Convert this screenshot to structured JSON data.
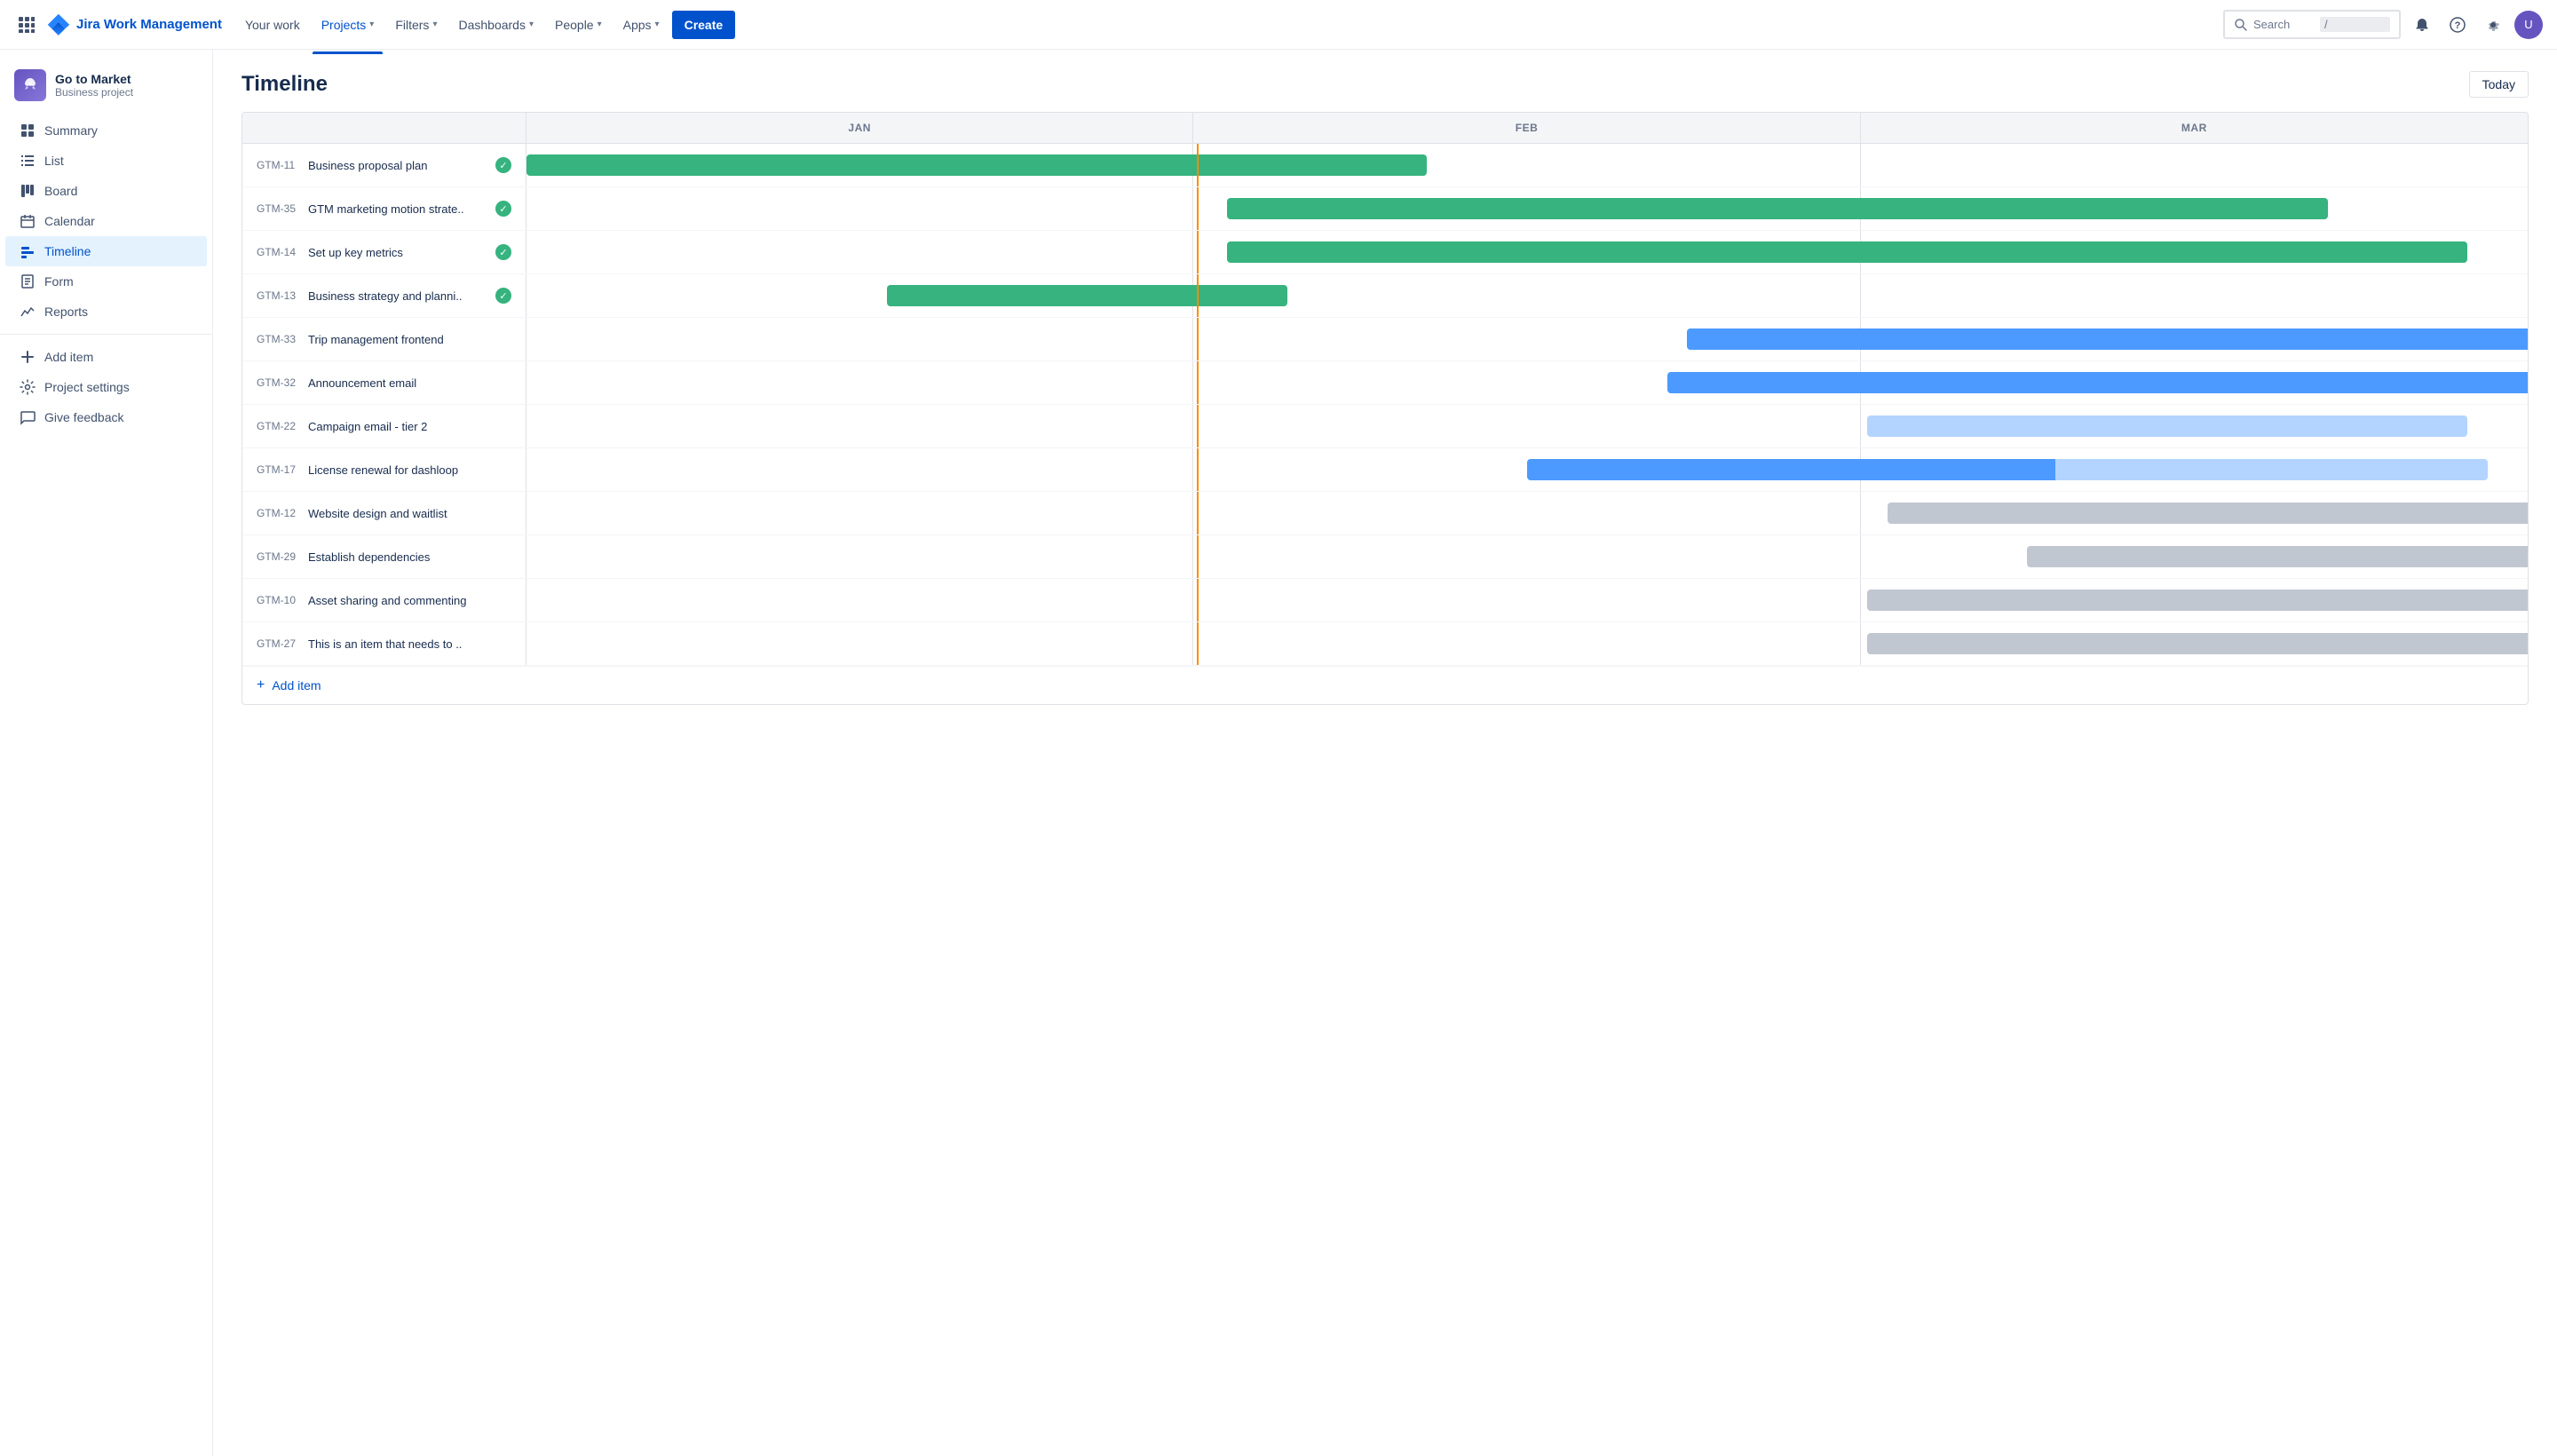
{
  "topnav": {
    "logo_text": "Jira Work Management",
    "nav_items": [
      {
        "label": "Your work",
        "active": false
      },
      {
        "label": "Projects",
        "active": true
      },
      {
        "label": "Filters",
        "active": false
      },
      {
        "label": "Dashboards",
        "active": false
      },
      {
        "label": "People",
        "active": false
      },
      {
        "label": "Apps",
        "active": false
      }
    ],
    "create_label": "Create",
    "search_placeholder": "Search",
    "search_shortcut": "/"
  },
  "project": {
    "name": "Go to Market",
    "type": "Business project"
  },
  "sidebar": {
    "items": [
      {
        "id": "summary",
        "label": "Summary",
        "icon": "summary"
      },
      {
        "id": "list",
        "label": "List",
        "icon": "list"
      },
      {
        "id": "board",
        "label": "Board",
        "icon": "board"
      },
      {
        "id": "calendar",
        "label": "Calendar",
        "icon": "calendar"
      },
      {
        "id": "timeline",
        "label": "Timeline",
        "icon": "timeline",
        "active": true
      },
      {
        "id": "form",
        "label": "Form",
        "icon": "form"
      },
      {
        "id": "reports",
        "label": "Reports",
        "icon": "reports"
      },
      {
        "id": "add-item",
        "label": "Add item",
        "icon": "add"
      },
      {
        "id": "project-settings",
        "label": "Project settings",
        "icon": "settings"
      },
      {
        "id": "give-feedback",
        "label": "Give feedback",
        "icon": "feedback"
      }
    ]
  },
  "page": {
    "title": "Timeline",
    "today_label": "Today"
  },
  "months": [
    "JAN",
    "FEB",
    "MAR"
  ],
  "timeline_rows": [
    {
      "id": "GTM-11",
      "name": "Business proposal plan",
      "done": true,
      "bar": {
        "color": "green",
        "col_start": "jan",
        "left_pct": 0,
        "width_pct": 45
      }
    },
    {
      "id": "GTM-35",
      "name": "GTM marketing motion strate..",
      "done": true,
      "bar": {
        "color": "green",
        "col_start": "jan",
        "left_pct": 35,
        "width_pct": 55
      }
    },
    {
      "id": "GTM-14",
      "name": "Set up key metrics",
      "done": true,
      "bar": {
        "color": "green",
        "col_start": "jan",
        "left_pct": 35,
        "width_pct": 62
      }
    },
    {
      "id": "GTM-13",
      "name": "Business strategy and planni..",
      "done": true,
      "bar": {
        "color": "green",
        "col_start": "jan",
        "left_pct": 18,
        "width_pct": 20
      }
    },
    {
      "id": "GTM-33",
      "name": "Trip management frontend",
      "done": false,
      "bar": {
        "color": "blue",
        "col_start": "jan",
        "left_pct": 58,
        "width_pct": 52
      }
    },
    {
      "id": "GTM-32",
      "name": "Announcement email",
      "done": false,
      "bar": {
        "color": "blue",
        "col_start": "jan",
        "left_pct": 57,
        "width_pct": 52
      }
    },
    {
      "id": "GTM-22",
      "name": "Campaign email - tier 2",
      "done": false,
      "bar": {
        "color": "lightblue",
        "col_start": "feb",
        "left_pct": 67,
        "width_pct": 30
      }
    },
    {
      "id": "GTM-17",
      "name": "License renewal for dashloop",
      "done": false,
      "bar": {
        "color": "mixed_blue",
        "col_start": "jan",
        "left_pct": 50,
        "width_pct": 48
      }
    },
    {
      "id": "GTM-12",
      "name": "Website design and waitlist",
      "done": false,
      "bar": {
        "color": "gray",
        "col_start": "feb",
        "left_pct": 68,
        "width_pct": 40
      }
    },
    {
      "id": "GTM-29",
      "name": "Establish dependencies",
      "done": false,
      "bar": {
        "color": "gray",
        "col_start": "mar",
        "left_pct": 75,
        "width_pct": 42
      }
    },
    {
      "id": "GTM-10",
      "name": "Asset sharing and commenting",
      "done": false,
      "bar": {
        "color": "gray",
        "col_start": "feb",
        "left_pct": 67,
        "width_pct": 35
      }
    },
    {
      "id": "GTM-27",
      "name": "This is an item that needs to ..",
      "done": false,
      "bar": {
        "color": "gray",
        "col_start": "feb",
        "left_pct": 67,
        "width_pct": 36
      }
    }
  ],
  "add_item_label": "+ Add item"
}
